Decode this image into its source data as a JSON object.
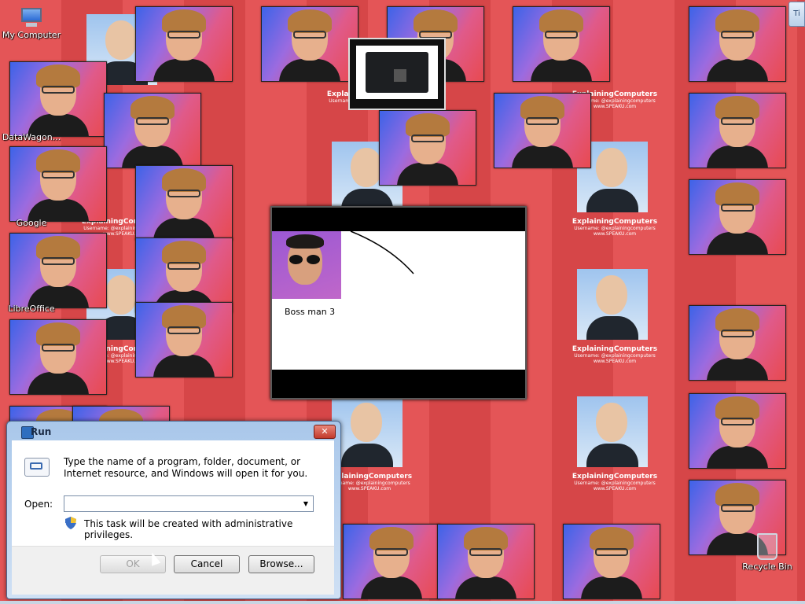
{
  "desktop": {
    "icons": [
      {
        "id": "my-computer",
        "label": "My Computer"
      },
      {
        "id": "datawagon",
        "label": "DataWagon..."
      },
      {
        "id": "google",
        "label": "Google"
      },
      {
        "id": "libreoffice",
        "label": "LibreOffice"
      },
      {
        "id": "recycle-bin",
        "label": "Recycle Bin"
      }
    ],
    "corner_tab_label": "Ti"
  },
  "watermark": {
    "title": "ExplainingComputers",
    "username": "Username: @explainingcomputers",
    "site": "www.SPEAKU.com"
  },
  "video_window": {
    "caption": "Boss man 3"
  },
  "run_dialog": {
    "title": "Run",
    "close_glyph": "✕",
    "description": "Type the name of a program, folder, document, or Internet resource, and Windows will open it for you.",
    "open_label": "Open:",
    "open_value": "",
    "dropdown_glyph": "▼",
    "admin_notice": "This task will be created with administrative privileges.",
    "buttons": {
      "ok": "OK",
      "cancel": "Cancel",
      "browse": "Browse..."
    }
  },
  "colors": {
    "desktop_bg": "#e24a4c",
    "dialog_frame": "#a9c7ea",
    "close_button": "#c23b2c"
  }
}
